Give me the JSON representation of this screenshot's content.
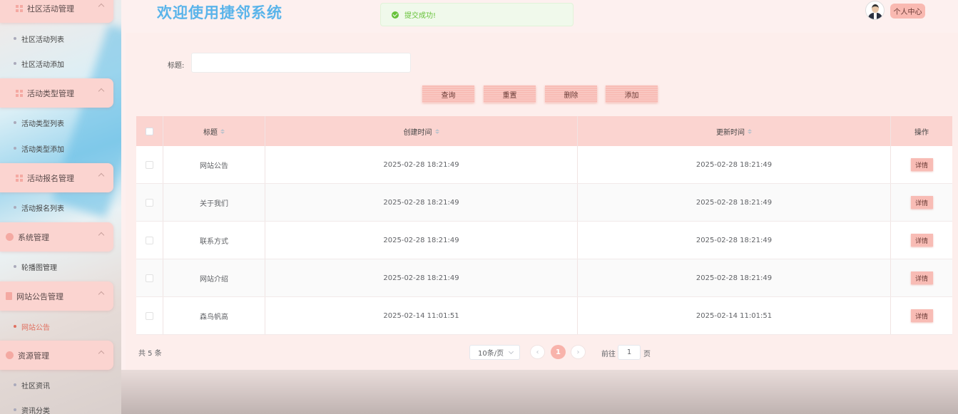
{
  "sidebar": {
    "groups": [
      {
        "label": "社区活动管理",
        "items": [
          "社区活动列表",
          "社区活动添加"
        ]
      },
      {
        "label": "活动类型管理",
        "items": [
          "活动类型列表",
          "活动类型添加"
        ]
      },
      {
        "label": "活动报名管理",
        "items": [
          "活动报名列表"
        ]
      },
      {
        "label": "系统管理",
        "items": [
          "轮播图管理"
        ]
      },
      {
        "label": "网站公告管理",
        "items": [
          "网站公告"
        ]
      },
      {
        "label": "资源管理",
        "items": [
          "社区资讯",
          "资讯分类"
        ]
      }
    ],
    "active_item": "网站公告"
  },
  "header": {
    "title": "欢迎使用捷邻系统",
    "toast": "提交成功!",
    "user_button": "个人中心"
  },
  "search": {
    "label": "标题:",
    "value": "",
    "placeholder": ""
  },
  "toolbar": {
    "query": "查询",
    "reset": "重置",
    "delete": "删除",
    "add": "添加"
  },
  "table": {
    "columns": {
      "title": "标题",
      "created": "创建时间",
      "updated": "更新时间",
      "actions": "操作"
    },
    "rows": [
      {
        "title": "网站公告",
        "created": "2025-02-28 18:21:49",
        "updated": "2025-02-28 18:21:49",
        "action": "详情"
      },
      {
        "title": "关于我们",
        "created": "2025-02-28 18:21:49",
        "updated": "2025-02-28 18:21:49",
        "action": "详情"
      },
      {
        "title": "联系方式",
        "created": "2025-02-28 18:21:49",
        "updated": "2025-02-28 18:21:49",
        "action": "详情"
      },
      {
        "title": "网站介绍",
        "created": "2025-02-28 18:21:49",
        "updated": "2025-02-28 18:21:49",
        "action": "详情"
      },
      {
        "title": "森鸟帆高",
        "created": "2025-02-14 11:01:51",
        "updated": "2025-02-14 11:01:51",
        "action": "详情"
      }
    ]
  },
  "pagination": {
    "total_text": "共 5 条",
    "page_size": "10条/页",
    "current_page": "1",
    "goto_label": "前往",
    "goto_value": "1",
    "goto_unit": "页",
    "prev_icon": "chevron-left-icon",
    "next_icon": "chevron-right-icon"
  },
  "colors": {
    "accent": "#f8bcb5",
    "title": "#5ab4ea",
    "success": "#67c23a",
    "active_menu": "#e07060"
  }
}
